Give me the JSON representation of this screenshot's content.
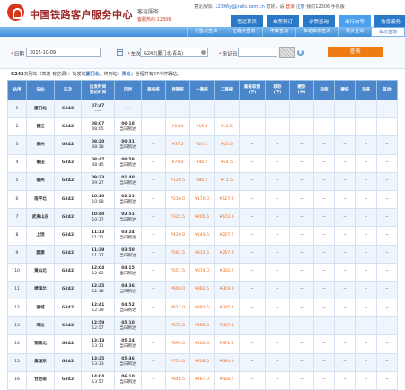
{
  "header": {
    "brand": "中国铁路客户服务中心",
    "service": "客运服务",
    "hotline": "客服热线:12306",
    "topline": {
      "greeting": "意见反馈:",
      "email": "12306yj@rails.com.cn",
      "welcome": "您好，请",
      "login": "登录",
      "register": "注册",
      "my": "我的12306",
      "mobile": "手机版"
    },
    "nav": [
      "客运首页",
      "车票预订",
      "余票查询",
      "出行向导",
      "信息服务"
    ],
    "nav_active": 3,
    "subnav": [
      "代售点查询",
      "正晚点查询",
      "中转查询",
      "车站车次查询",
      "票价查询",
      "车次查询"
    ],
    "subnav_active": 5
  },
  "search": {
    "date_label": "日期",
    "date_value": "2015-10-09",
    "train_label": "车次",
    "train_value": "G242(厦门北-青岛)",
    "code_label": "验证码",
    "code_placeholder": "",
    "button": "查询"
  },
  "info": {
    "train": "G242",
    "prefix": "次列车（高速 有空调）：始发站",
    "origin": "厦门北",
    "mid": "，终到站：",
    "dest": "青岛",
    "suffix": "；全程共有27个停靠站。"
  },
  "table": {
    "headers": [
      "站序",
      "车站",
      "车次",
      "出发时间\n到达时间",
      "历时",
      "商务座",
      "特等座",
      "一等座",
      "二等座",
      "高级软卧\n(下)",
      "软卧\n(下)",
      "硬卧\n(中)",
      "软座",
      "硬座",
      "无座",
      "其他"
    ],
    "rows": [
      {
        "no": "1",
        "station": "厦门北",
        "train": "G242",
        "dep": "07:47",
        "arr": "----",
        "dur": "----",
        "sp": "--",
        "fc": "--",
        "sc": "--"
      },
      {
        "no": "2",
        "station": "晋江",
        "train": "G242",
        "dep": "08:07",
        "arr": "08:05",
        "dur": "00:18",
        "day": "当日到达",
        "sp": "¥24.0",
        "fc": "¥15.5",
        "sc": "¥12.5"
      },
      {
        "no": "3",
        "station": "泉州",
        "train": "G242",
        "dep": "08:20",
        "arr": "08:18",
        "dur": "00:31",
        "day": "当日到达",
        "sp": "¥37.5",
        "fc": "¥24.5",
        "sc": "¥20.0"
      },
      {
        "no": "4",
        "station": "莆田",
        "train": "G242",
        "dep": "08:47",
        "arr": "08:45",
        "dur": "00:58",
        "day": "当日到达",
        "sp": "¥74.0",
        "fc": "¥46.5",
        "sc": "¥44.5"
      },
      {
        "no": "5",
        "station": "福州",
        "train": "G242",
        "dep": "09:33",
        "arr": "09:27",
        "dur": "01:40",
        "day": "当日到达",
        "sp": "¥120.5",
        "fc": "¥80.5",
        "sc": "¥71.5"
      },
      {
        "no": "6",
        "station": "南平北",
        "train": "G242",
        "dep": "10:10",
        "arr": "10:08",
        "dur": "02:21",
        "day": "当日到达",
        "sp": "¥236.0",
        "fc": "¥170.0",
        "sc": "¥127.0"
      },
      {
        "no": "7",
        "station": "武夷山东",
        "train": "G242",
        "dep": "10:40",
        "arr": "10:37",
        "dur": "02:51",
        "day": "当日到达",
        "sp": "¥325.5",
        "fc": "¥205.5",
        "sc": "¥172.0"
      },
      {
        "no": "8",
        "station": "上饶",
        "train": "G242",
        "dep": "11:13",
        "arr": "11:11",
        "dur": "03:24",
        "day": "当日到达",
        "sp": "¥426.0",
        "fc": "¥249.5",
        "sc": "¥227.5"
      },
      {
        "no": "9",
        "station": "婺源",
        "train": "G242",
        "dep": "11:39",
        "arr": "11:37",
        "dur": "03:50",
        "day": "当日到达",
        "sp": "¥501.5",
        "fc": "¥315.5",
        "sc": "¥267.0"
      },
      {
        "no": "10",
        "station": "黄山北",
        "train": "G242",
        "dep": "12:04",
        "arr": "12:02",
        "dur": "04:15",
        "day": "当日到达",
        "sp": "¥557.5",
        "fc": "¥374.0",
        "sc": "¥302.5"
      },
      {
        "no": "11",
        "station": "绩溪北",
        "train": "G242",
        "dep": "12:25",
        "arr": "12:18",
        "dur": "04:36",
        "day": "当日到达",
        "sp": "¥608.0",
        "fc": "¥382.5",
        "sc": "¥319.0"
      },
      {
        "no": "12",
        "station": "宣城",
        "train": "G242",
        "dep": "12:41",
        "arr": "12:39",
        "dur": "04:52",
        "day": "当日到达",
        "sp": "¥622.0",
        "fc": "¥393.5",
        "sc": "¥335.0"
      },
      {
        "no": "13",
        "station": "湾沚",
        "train": "G242",
        "dep": "12:59",
        "arr": "12:57",
        "dur": "05:10",
        "day": "当日到达",
        "sp": "¥672.0",
        "fc": "¥405.0",
        "sc": "¥367.0"
      },
      {
        "no": "14",
        "station": "铜陵北",
        "train": "G242",
        "dep": "13:13",
        "arr": "13:11",
        "dur": "05:24",
        "day": "当日到达",
        "sp": "¥699.0",
        "fc": "¥426.5",
        "sc": "¥371.0"
      },
      {
        "no": "15",
        "station": "巢湖东",
        "train": "G242",
        "dep": "13:35",
        "arr": "13:33",
        "dur": "05:46",
        "day": "当日到达",
        "sp": "¥753.0",
        "fc": "¥438.5",
        "sc": "¥394.0"
      },
      {
        "no": "16",
        "station": "合肥南",
        "train": "G242",
        "dep": "14:04",
        "arr": "13:57",
        "dur": "06:10",
        "day": "当日到达",
        "sp": "¥846.5",
        "fc": "¥467.0",
        "sc": "¥428.5"
      }
    ]
  }
}
